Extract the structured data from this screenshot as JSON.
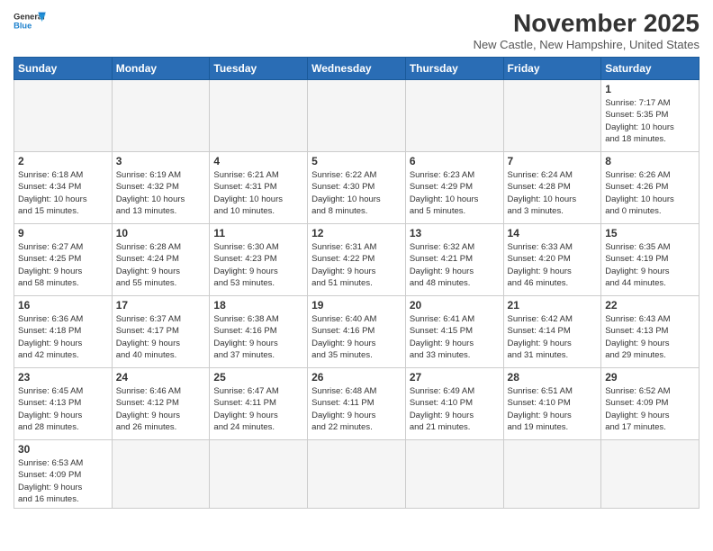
{
  "header": {
    "logo_general": "General",
    "logo_blue": "Blue",
    "month_title": "November 2025",
    "location": "New Castle, New Hampshire, United States"
  },
  "days_of_week": [
    "Sunday",
    "Monday",
    "Tuesday",
    "Wednesday",
    "Thursday",
    "Friday",
    "Saturday"
  ],
  "weeks": [
    [
      {
        "day": "",
        "info": ""
      },
      {
        "day": "",
        "info": ""
      },
      {
        "day": "",
        "info": ""
      },
      {
        "day": "",
        "info": ""
      },
      {
        "day": "",
        "info": ""
      },
      {
        "day": "",
        "info": ""
      },
      {
        "day": "1",
        "info": "Sunrise: 7:17 AM\nSunset: 5:35 PM\nDaylight: 10 hours\nand 18 minutes."
      }
    ],
    [
      {
        "day": "2",
        "info": "Sunrise: 6:18 AM\nSunset: 4:34 PM\nDaylight: 10 hours\nand 15 minutes."
      },
      {
        "day": "3",
        "info": "Sunrise: 6:19 AM\nSunset: 4:32 PM\nDaylight: 10 hours\nand 13 minutes."
      },
      {
        "day": "4",
        "info": "Sunrise: 6:21 AM\nSunset: 4:31 PM\nDaylight: 10 hours\nand 10 minutes."
      },
      {
        "day": "5",
        "info": "Sunrise: 6:22 AM\nSunset: 4:30 PM\nDaylight: 10 hours\nand 8 minutes."
      },
      {
        "day": "6",
        "info": "Sunrise: 6:23 AM\nSunset: 4:29 PM\nDaylight: 10 hours\nand 5 minutes."
      },
      {
        "day": "7",
        "info": "Sunrise: 6:24 AM\nSunset: 4:28 PM\nDaylight: 10 hours\nand 3 minutes."
      },
      {
        "day": "8",
        "info": "Sunrise: 6:26 AM\nSunset: 4:26 PM\nDaylight: 10 hours\nand 0 minutes."
      }
    ],
    [
      {
        "day": "9",
        "info": "Sunrise: 6:27 AM\nSunset: 4:25 PM\nDaylight: 9 hours\nand 58 minutes."
      },
      {
        "day": "10",
        "info": "Sunrise: 6:28 AM\nSunset: 4:24 PM\nDaylight: 9 hours\nand 55 minutes."
      },
      {
        "day": "11",
        "info": "Sunrise: 6:30 AM\nSunset: 4:23 PM\nDaylight: 9 hours\nand 53 minutes."
      },
      {
        "day": "12",
        "info": "Sunrise: 6:31 AM\nSunset: 4:22 PM\nDaylight: 9 hours\nand 51 minutes."
      },
      {
        "day": "13",
        "info": "Sunrise: 6:32 AM\nSunset: 4:21 PM\nDaylight: 9 hours\nand 48 minutes."
      },
      {
        "day": "14",
        "info": "Sunrise: 6:33 AM\nSunset: 4:20 PM\nDaylight: 9 hours\nand 46 minutes."
      },
      {
        "day": "15",
        "info": "Sunrise: 6:35 AM\nSunset: 4:19 PM\nDaylight: 9 hours\nand 44 minutes."
      }
    ],
    [
      {
        "day": "16",
        "info": "Sunrise: 6:36 AM\nSunset: 4:18 PM\nDaylight: 9 hours\nand 42 minutes."
      },
      {
        "day": "17",
        "info": "Sunrise: 6:37 AM\nSunset: 4:17 PM\nDaylight: 9 hours\nand 40 minutes."
      },
      {
        "day": "18",
        "info": "Sunrise: 6:38 AM\nSunset: 4:16 PM\nDaylight: 9 hours\nand 37 minutes."
      },
      {
        "day": "19",
        "info": "Sunrise: 6:40 AM\nSunset: 4:16 PM\nDaylight: 9 hours\nand 35 minutes."
      },
      {
        "day": "20",
        "info": "Sunrise: 6:41 AM\nSunset: 4:15 PM\nDaylight: 9 hours\nand 33 minutes."
      },
      {
        "day": "21",
        "info": "Sunrise: 6:42 AM\nSunset: 4:14 PM\nDaylight: 9 hours\nand 31 minutes."
      },
      {
        "day": "22",
        "info": "Sunrise: 6:43 AM\nSunset: 4:13 PM\nDaylight: 9 hours\nand 29 minutes."
      }
    ],
    [
      {
        "day": "23",
        "info": "Sunrise: 6:45 AM\nSunset: 4:13 PM\nDaylight: 9 hours\nand 28 minutes."
      },
      {
        "day": "24",
        "info": "Sunrise: 6:46 AM\nSunset: 4:12 PM\nDaylight: 9 hours\nand 26 minutes."
      },
      {
        "day": "25",
        "info": "Sunrise: 6:47 AM\nSunset: 4:11 PM\nDaylight: 9 hours\nand 24 minutes."
      },
      {
        "day": "26",
        "info": "Sunrise: 6:48 AM\nSunset: 4:11 PM\nDaylight: 9 hours\nand 22 minutes."
      },
      {
        "day": "27",
        "info": "Sunrise: 6:49 AM\nSunset: 4:10 PM\nDaylight: 9 hours\nand 21 minutes."
      },
      {
        "day": "28",
        "info": "Sunrise: 6:51 AM\nSunset: 4:10 PM\nDaylight: 9 hours\nand 19 minutes."
      },
      {
        "day": "29",
        "info": "Sunrise: 6:52 AM\nSunset: 4:09 PM\nDaylight: 9 hours\nand 17 minutes."
      }
    ],
    [
      {
        "day": "30",
        "info": "Sunrise: 6:53 AM\nSunset: 4:09 PM\nDaylight: 9 hours\nand 16 minutes."
      },
      {
        "day": "",
        "info": ""
      },
      {
        "day": "",
        "info": ""
      },
      {
        "day": "",
        "info": ""
      },
      {
        "day": "",
        "info": ""
      },
      {
        "day": "",
        "info": ""
      },
      {
        "day": "",
        "info": ""
      }
    ]
  ]
}
